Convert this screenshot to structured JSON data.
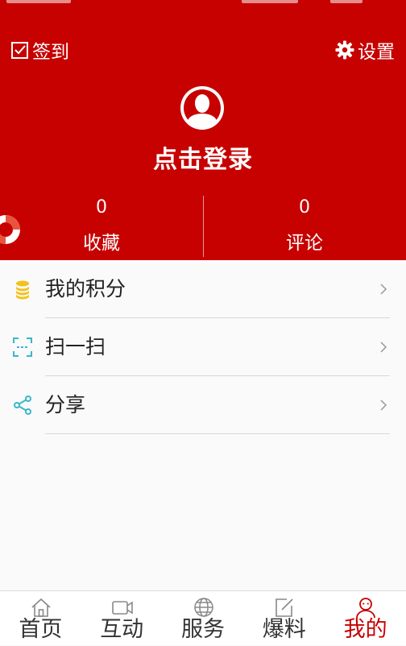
{
  "header": {
    "checkin_label": "签到",
    "settings_label": "设置",
    "login_label": "点击登录",
    "stats": [
      {
        "value": "0",
        "label": "收藏"
      },
      {
        "value": "0",
        "label": "评论"
      }
    ]
  },
  "menu": {
    "items": [
      {
        "label": "我的积分",
        "icon": "coins-icon"
      },
      {
        "label": "扫一扫",
        "icon": "scan-icon"
      },
      {
        "label": "分享",
        "icon": "share-icon"
      }
    ]
  },
  "tabbar": {
    "tabs": [
      {
        "label": "首页",
        "icon": "home-icon"
      },
      {
        "label": "互动",
        "icon": "video-icon"
      },
      {
        "label": "服务",
        "icon": "globe-icon"
      },
      {
        "label": "爆料",
        "icon": "edit-icon"
      },
      {
        "label": "我的",
        "icon": "user-icon",
        "active": true
      }
    ]
  },
  "colors": {
    "brand_red": "#c70000",
    "coin_yellow": "#f2c21b",
    "scan_teal": "#39b7c9",
    "share_teal": "#39b7c9"
  }
}
